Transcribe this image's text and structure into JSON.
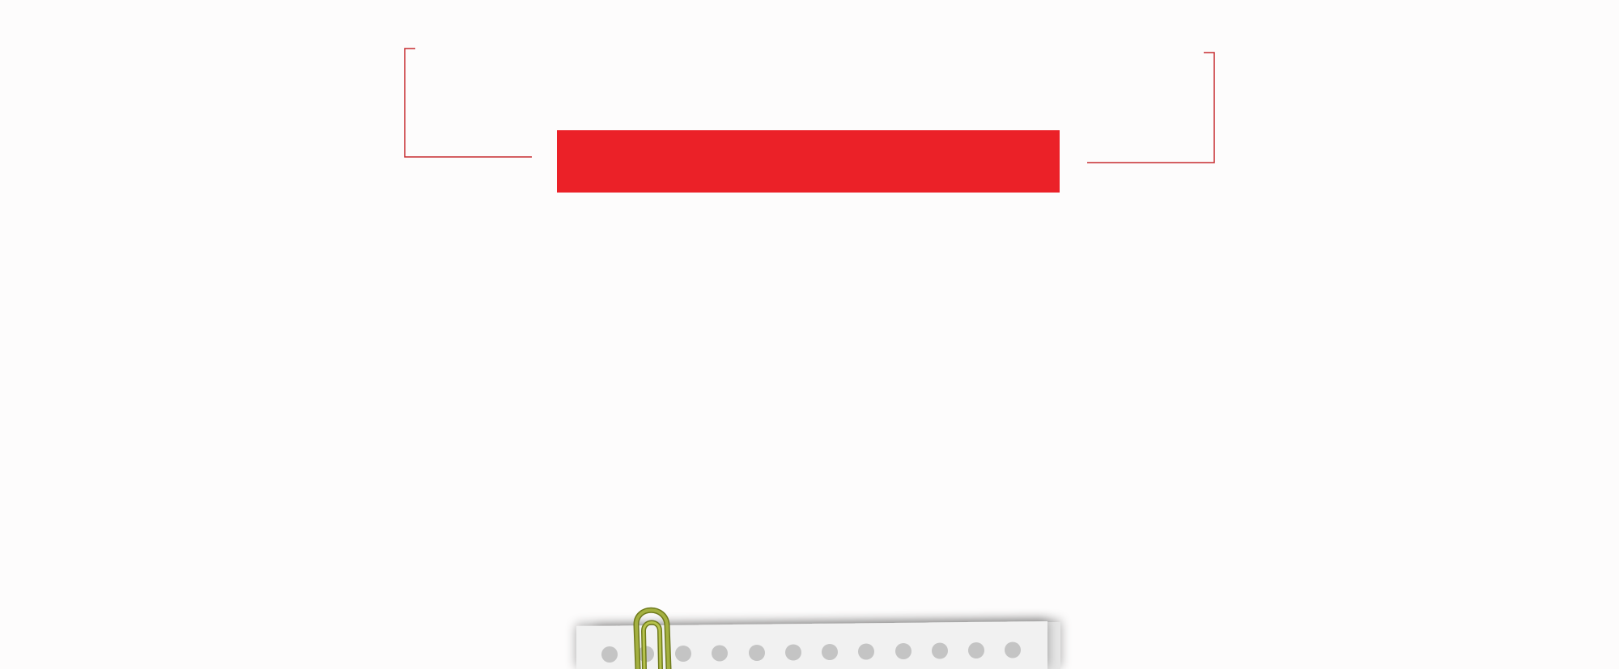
{
  "banner": {
    "text": ""
  },
  "colors": {
    "background": "#fdfcfc",
    "banner": "#eb2128",
    "bracket_line": "#c62b2f",
    "paper": "#f1f1f1",
    "paper_hole": "#c4c4c4",
    "paperclip": "#9aa53a"
  },
  "decorations": {
    "left_bracket": "corner-bracket-top-left",
    "right_bracket": "corner-bracket-top-right",
    "note_icon": "notebook-paper-with-paperclip"
  }
}
